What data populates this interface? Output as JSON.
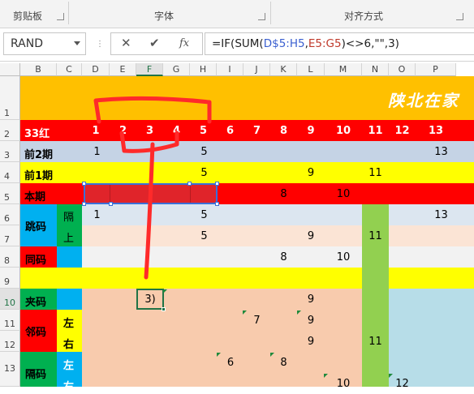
{
  "ribbon": {
    "groups": [
      {
        "label": "剪贴板"
      },
      {
        "label": "字体"
      },
      {
        "label": "对齐方式"
      }
    ]
  },
  "formula_bar": {
    "name_box": "RAND",
    "cancel_icon": "✕",
    "enter_icon": "✔",
    "fx_label": "fx",
    "formula_prefix": "=IF(SUM(",
    "formula_ref1": "D$5:H5",
    "formula_comma": ",",
    "formula_ref2": "E5:G5",
    "formula_suffix": ")<>6,\"\",3)"
  },
  "columns": [
    "B",
    "C",
    "D",
    "E",
    "F",
    "G",
    "H",
    "I",
    "J",
    "K",
    "L",
    "M",
    "N",
    "O",
    "P"
  ],
  "selected_column": "F",
  "rows": [
    "1",
    "2",
    "3",
    "4",
    "5",
    "6",
    "7",
    "8",
    "9",
    "10",
    "11",
    "12",
    "13"
  ],
  "selected_row": "10",
  "sheet": {
    "title_text": "陕北在家",
    "row2_label": "33红",
    "header_numbers": [
      "1",
      "2",
      "3",
      "4",
      "5",
      "6",
      "7",
      "8",
      "9",
      "10",
      "11",
      "12",
      "13"
    ],
    "labels": {
      "r3": "前2期",
      "r4": "前1期",
      "r5": "本期",
      "jump": "跳码",
      "ge": "隔",
      "shang": "上",
      "tong": "同码",
      "jia": "夹码",
      "lin": "邻码",
      "zuo1": "左",
      "you1": "右",
      "gema": "隔码",
      "zuo2": "左",
      "you2": "右"
    },
    "r3_values": [
      "1",
      "5",
      "13"
    ],
    "r4_values": [
      "5",
      "9",
      "11"
    ],
    "r5_values": [
      "8",
      "10"
    ],
    "r6_values": [
      "1",
      "5",
      "13"
    ],
    "r7_values": [
      "5",
      "9",
      "11"
    ],
    "r8_values": [
      "8",
      "10"
    ],
    "r10_values": [
      "9"
    ],
    "active_cell_text": "3)",
    "r11_values": [
      "7",
      "9"
    ],
    "r12_values": [
      "9",
      "11"
    ],
    "r13_values": [
      "6",
      "8"
    ],
    "r14_values": [
      "10",
      "12"
    ]
  },
  "colors": {
    "title_bg": "#ffc000",
    "red": "#ff0000",
    "yellow": "#ffff00",
    "blue_gray": "#c5d3e5",
    "peach": "#fbe4d5",
    "salmon": "#f8cbad",
    "green": "#92d050",
    "teal_green": "#00b050",
    "light_blue": "#b7dde8",
    "sky": "#00b0f0",
    "selection_fill": "#e0242a",
    "annotation": "#ff2a2a"
  }
}
